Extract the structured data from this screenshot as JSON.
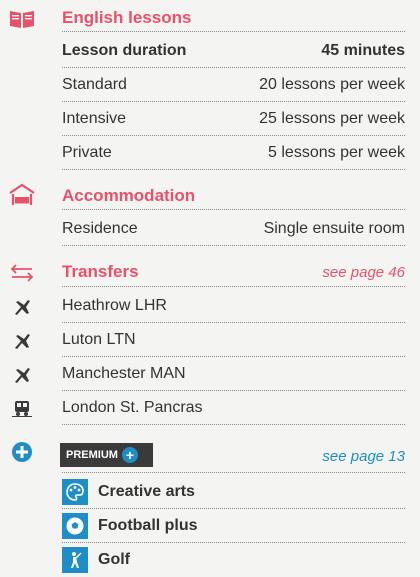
{
  "lessons": {
    "title": "English lessons",
    "duration_label": "Lesson duration",
    "duration_value": "45 minutes",
    "rows": [
      {
        "label": "Standard",
        "value": "20 lessons per week"
      },
      {
        "label": "Intensive",
        "value": "25 lessons per week"
      },
      {
        "label": "Private",
        "value": "5 lessons per week"
      }
    ]
  },
  "accommodation": {
    "title": "Accommodation",
    "rows": [
      {
        "label": "Residence",
        "value": "Single ensuite room"
      }
    ]
  },
  "transfers": {
    "title": "Transfers",
    "see": "see page 46",
    "rows": [
      "Heathrow LHR",
      "Luton LTN",
      "Manchester MAN",
      "London St. Pancras"
    ]
  },
  "premium": {
    "badge": "PREMIUM",
    "see": "see page 13",
    "activities": [
      "Creative arts",
      "Football plus",
      "Golf"
    ]
  },
  "colors": {
    "accent_pink": "#e8516a",
    "accent_blue": "#1f8ec7",
    "background": "#f4f4f3"
  },
  "icons": {
    "lessons": "book-icon",
    "accommodation": "bed-icon",
    "transfers": "transfer-arrows-icon",
    "airport": "plane-icon",
    "rail": "train-icon",
    "premium": "plus-circle-icon",
    "activities": [
      "palette-icon",
      "football-icon",
      "golfer-icon"
    ]
  }
}
